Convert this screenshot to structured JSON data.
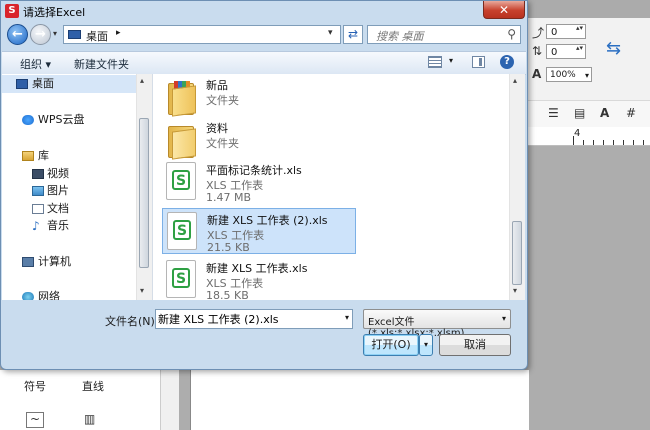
{
  "dialog": {
    "title": "请选择Excel",
    "close_label": "✕",
    "address": {
      "location": "桌面",
      "arrow": "▸"
    },
    "search_placeholder": "搜索 桌面",
    "refresh_icon": "refresh-icon",
    "commands": {
      "organize": "组织 ▾",
      "new_folder": "新建文件夹",
      "help": "?"
    },
    "nav_items": [
      {
        "label": "桌面",
        "icon": "desktop-icon",
        "selected": true
      },
      {
        "label": "WPS云盘",
        "icon": "cloud-icon"
      },
      {
        "label": "库",
        "icon": "library-icon"
      },
      {
        "label": "视频",
        "icon": "video-icon"
      },
      {
        "label": "图片",
        "icon": "picture-icon"
      },
      {
        "label": "文档",
        "icon": "document-icon"
      },
      {
        "label": "音乐",
        "icon": "music-icon"
      },
      {
        "label": "计算机",
        "icon": "computer-icon"
      },
      {
        "label": "网络",
        "icon": "network-icon"
      }
    ],
    "files": [
      {
        "name": "新品",
        "type": "文件夹",
        "size": "",
        "icon": "folder-books-icon"
      },
      {
        "name": "资料",
        "type": "文件夹",
        "size": "",
        "icon": "folder-icon"
      },
      {
        "name": "平面标记条统计.xls",
        "type": "XLS 工作表",
        "size": "1.47 MB",
        "icon": "xls-icon"
      },
      {
        "name": "新建 XLS 工作表 (2).xls",
        "type": "XLS 工作表",
        "size": "21.5 KB",
        "icon": "xls-icon",
        "selected": true
      },
      {
        "name": "新建 XLS 工作表.xls",
        "type": "XLS 工作表",
        "size": "18.5 KB",
        "icon": "xls-icon"
      }
    ],
    "filename_label": "文件名(N):",
    "filename_value": "新建 XLS 工作表 (2).xls",
    "filter_value": "Excel文件(*.xls;*.xlsx;*.xlsm)",
    "open_label": "打开(O)",
    "cancel_label": "取消"
  },
  "background": {
    "spin1": "0",
    "spin2": "0",
    "zoom": "100%",
    "ruler_mark": "4",
    "tool_symbol": "符号",
    "tool_line": "直线"
  },
  "colors": {
    "accent": "#2c64b0",
    "selection": "#cde3fa",
    "xls_green": "#2ea043",
    "close_red": "#c7412d"
  }
}
